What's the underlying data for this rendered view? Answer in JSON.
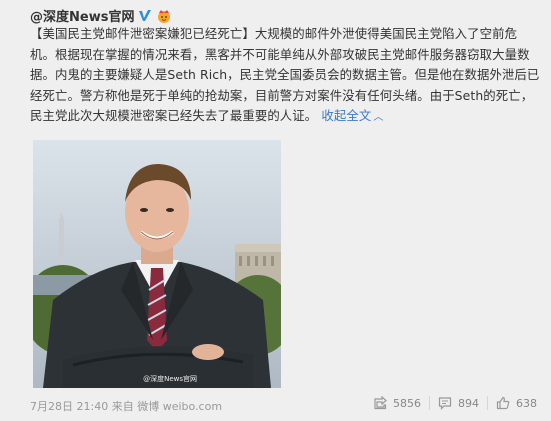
{
  "author": {
    "name": "@深度News官网",
    "verified_icon": "verified-v-icon",
    "vip_icon": "vip-crown-icon"
  },
  "post": {
    "text": "【美国民主党邮件泄密案嫌犯已经死亡】大规模的邮件外泄使得美国民主党陷入了空前危机。根据现在掌握的情况来看，黑客并不可能单纯从外部攻破民主党邮件服务器窃取大量数据。内鬼的主要嫌疑人是Seth Rich，民主党全国委员会的数据主管。但是他在数据外泄后已经死亡。警方称他是死于单纯的抢劫案，目前警方对案件没有任何头绪。由于Seth的死亡，民主党此次大规模泄密案已经失去了最重要的人证。",
    "collapse_label": "收起全文"
  },
  "photo": {
    "watermark": "@深度News官网"
  },
  "footer": {
    "timestamp": "7月28日 21:40",
    "from_label": "来自",
    "source": "微博 weibo.com",
    "repost_count": "5856",
    "comment_count": "894",
    "like_count": "638"
  },
  "colors": {
    "link": "#3a7bc8",
    "verified": "#2e8fd6",
    "text": "#333333",
    "muted": "#999999"
  }
}
